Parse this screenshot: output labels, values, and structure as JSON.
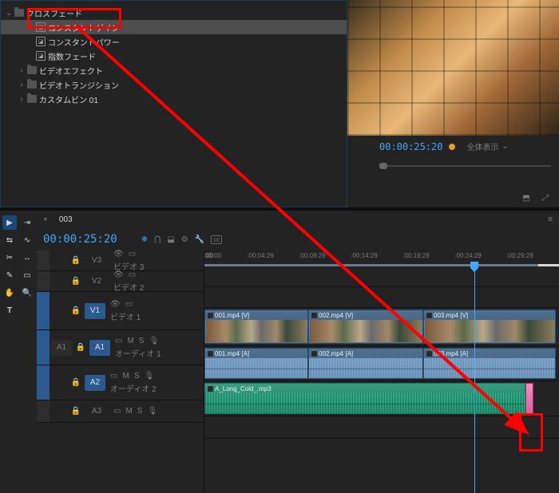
{
  "effects_tree": {
    "root": {
      "label": "クロスフェード"
    },
    "items": [
      {
        "label": "コンスタントゲイン",
        "selected": true
      },
      {
        "label": "コンスタントパワー"
      },
      {
        "label": "指数フェード"
      }
    ],
    "siblings": [
      {
        "label": "ビデオエフェクト"
      },
      {
        "label": "ビデオトランジション"
      },
      {
        "label": "カスタムビン 01"
      }
    ]
  },
  "preview": {
    "timecode": "00:00:25:20",
    "zoom_label": "全体表示"
  },
  "timeline": {
    "tab": "003",
    "timecode": "00:00:25:20",
    "ruler": [
      ":00:00",
      ":00:00",
      ":00:04:29",
      ":00:09:29",
      ":00:14:29",
      ":00:19:29",
      ":00:24:29",
      ":00:29:29"
    ],
    "tracks": {
      "v3": {
        "name": "V3",
        "label": "ビデオ 3"
      },
      "v2": {
        "name": "V2",
        "label": "ビデオ 2"
      },
      "v1": {
        "name": "V1",
        "label": "ビデオ 1"
      },
      "a1": {
        "name": "A1",
        "label": "オーディオ 1",
        "patch": "A1"
      },
      "a2": {
        "name": "A2",
        "label": "オーディオ 2"
      },
      "a3": {
        "name": "A3",
        "label": ""
      }
    },
    "clips": {
      "v1": [
        {
          "title": "001.mp4 [V]",
          "start": 0,
          "end": 130
        },
        {
          "title": "002.mp4 [V]",
          "start": 130,
          "end": 274
        },
        {
          "title": "003.mp4 [V]",
          "start": 274,
          "end": 440
        }
      ],
      "a1": [
        {
          "title": "001.mp4 [A]",
          "start": 0,
          "end": 130
        },
        {
          "title": "002.mp4 [A]",
          "start": 130,
          "end": 274
        },
        {
          "title": "003.mp4 [A]",
          "start": 274,
          "end": 440
        }
      ],
      "a2": [
        {
          "title": "A_Long_Cold_.mp3",
          "start": 0,
          "end": 402
        }
      ]
    },
    "transition_label": "",
    "ms": {
      "m": "M",
      "s": "S"
    }
  }
}
